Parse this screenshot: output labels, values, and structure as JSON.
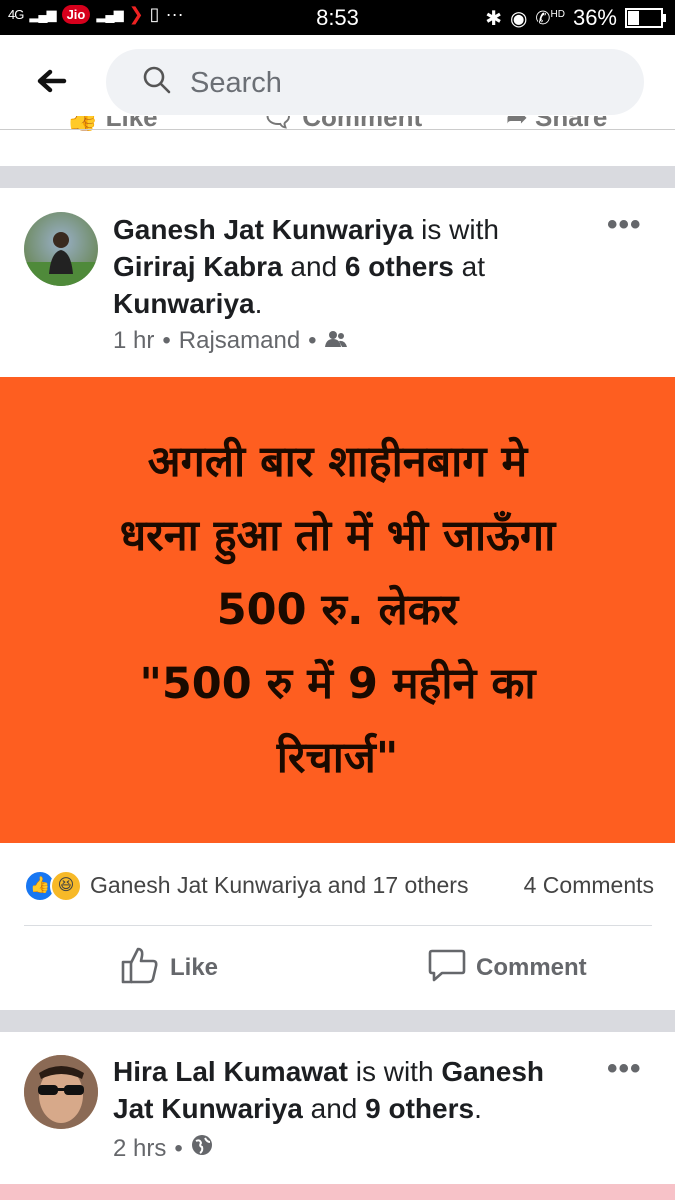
{
  "status_bar": {
    "left_carrier": "Jio",
    "network": "4G",
    "time": "8:53",
    "hd_label": "HD",
    "battery": "36%"
  },
  "search": {
    "placeholder": "Search"
  },
  "prev_post_actions": {
    "like": "Like",
    "comment": "Comment",
    "share": "Share"
  },
  "post1": {
    "author": "Ganesh Jat Kunwariya",
    "with_word": " is with ",
    "tagged": "Giriraj Kabra",
    "and_word": " and ",
    "others": "6 others",
    "at_word": " at ",
    "location": "Kunwariya",
    "period": ".",
    "time": "1 hr",
    "place": "Rajsamand",
    "audience_icon": "friends-icon",
    "banner_color": "#fe5e20",
    "banner_text": "अगली बार शाहीनबाग मे\nधरना हुआ तो में भी जाऊँगा\n500 रु. लेकर\n\"500 रु में 9 महीने का\nरिचार्ज\"",
    "reaction_names": "Ganesh Jat Kunwariya and 17 others",
    "comments_count": "4 Comments",
    "like_label": "Like",
    "comment_label": "Comment"
  },
  "post2": {
    "author": "Hira Lal Kumawat",
    "with_word": " is with ",
    "tagged": "Ganesh Jat Kunwariya",
    "and_word": " and ",
    "others": "9 others",
    "period": ".",
    "time": "2 hrs",
    "audience_icon": "globe-icon"
  },
  "colors": {
    "accent": "#1877f2",
    "banner": "#fe5e20",
    "separator": "#d9dadf"
  }
}
